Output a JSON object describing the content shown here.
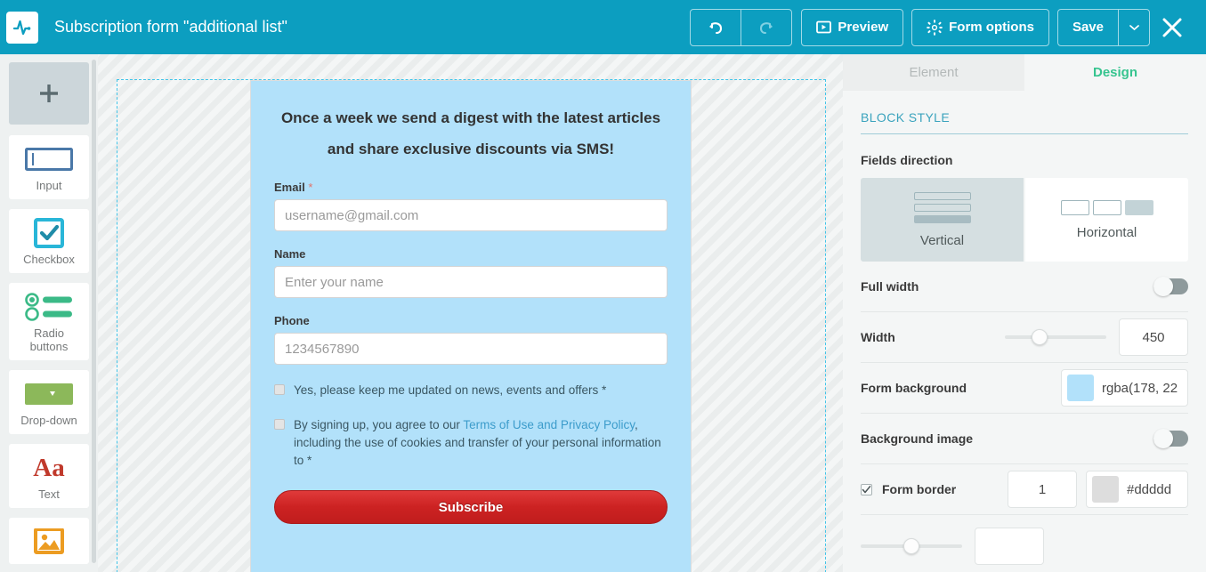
{
  "header": {
    "logo_icon": "pulse-logo-icon",
    "title": "Subscription form \"additional list\"",
    "undo_icon": "undo-arrow-icon",
    "redo_icon": "redo-arrow-icon",
    "preview_label": "Preview",
    "preview_icon": "play-box-icon",
    "form_options_label": "Form options",
    "form_options_icon": "gear-icon",
    "save_label": "Save",
    "save_caret_icon": "chevron-down-icon",
    "close_icon": "close-x-icon",
    "accent_color": "#0c9ec0"
  },
  "sidebar": {
    "add_label": "+",
    "items": [
      {
        "label": "Input",
        "icon": "text-input-icon",
        "color": "#4a78a8"
      },
      {
        "label": "Checkbox",
        "icon": "checkbox-checked-icon",
        "color": "#29b6d8"
      },
      {
        "label": "Radio\nbuttons",
        "label_line1": "Radio",
        "label_line2": "buttons",
        "icon": "radio-buttons-icon",
        "color": "#3bba87"
      },
      {
        "label": "Drop-down",
        "icon": "dropdown-icon",
        "color": "#8cb85a"
      },
      {
        "label": "Text",
        "icon": "text-aa-icon",
        "text_glyph": "Aa",
        "color": "#c0392b"
      },
      {
        "label": "",
        "icon": "image-icon",
        "color": "#ec9c22"
      }
    ]
  },
  "form": {
    "heading": "Once a week we send a digest with the latest articles and share exclusive discounts via SMS!",
    "background_color": "#b2e1fa",
    "fields": [
      {
        "label": "Email",
        "required": true,
        "required_mark": "*",
        "placeholder": "username@gmail.com",
        "name": "email-field"
      },
      {
        "label": "Name",
        "required": false,
        "required_mark": "",
        "placeholder": "Enter your name",
        "name": "name-field"
      },
      {
        "label": "Phone",
        "required": false,
        "required_mark": "",
        "placeholder": "1234567890",
        "name": "phone-field"
      }
    ],
    "consent_1": {
      "text": "Yes, please keep me updated on news, events and offers *",
      "checked": false
    },
    "consent_2": {
      "text_before": "By signing up, you agree to our ",
      "link_text": "Terms of Use and Privacy Policy",
      "text_after": ", including the use of cookies and transfer of your personal information to  *",
      "checked": false
    },
    "submit_label": "Subscribe",
    "submit_color": "#cc2222"
  },
  "panel": {
    "tabs": [
      {
        "label": "Element",
        "active": false
      },
      {
        "label": "Design",
        "active": true
      }
    ],
    "active_tab_color": "#36c48f",
    "section_title": "BLOCK STYLE",
    "fields_direction": {
      "label": "Fields direction",
      "options": [
        {
          "label": "Vertical",
          "selected": true
        },
        {
          "label": "Horizontal",
          "selected": false
        }
      ]
    },
    "full_width": {
      "label": "Full width",
      "enabled": false
    },
    "width": {
      "label": "Width",
      "value": "450",
      "slider_percent": 30
    },
    "form_background": {
      "label": "Form background",
      "value": "rgba(178, 22",
      "swatch_color": "#b2e1fa"
    },
    "background_image": {
      "label": "Background image",
      "enabled": false
    },
    "form_border": {
      "label": "Form border",
      "checked": true,
      "check_glyph": "✔",
      "width_value": "1",
      "color_value": "#dddddd",
      "color_display": "#ddddd",
      "swatch_color": "#dddddd"
    }
  }
}
